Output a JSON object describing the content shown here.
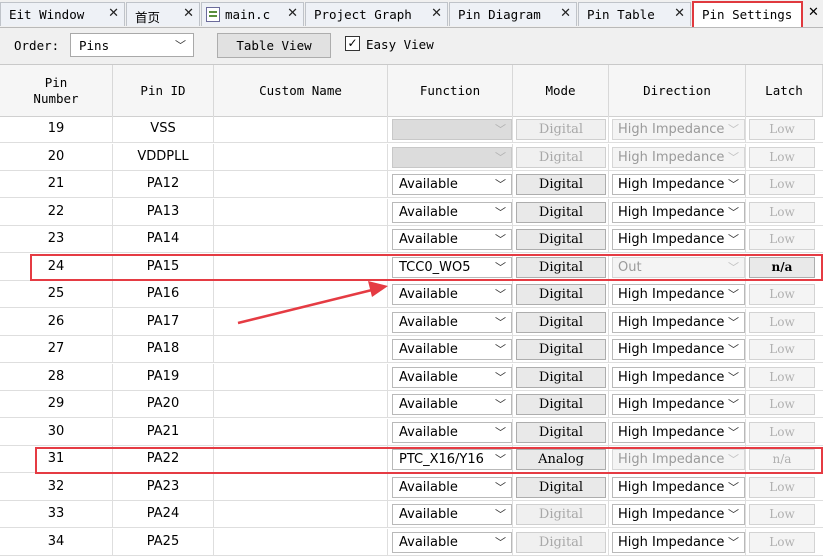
{
  "tabs": [
    {
      "label": "Eit Window",
      "active": false,
      "icon": null
    },
    {
      "label": "首页",
      "active": false,
      "icon": null
    },
    {
      "label": "main.c",
      "active": false,
      "icon": "c-file-icon"
    },
    {
      "label": "Project Graph",
      "active": false,
      "icon": null
    },
    {
      "label": "Pin Diagram",
      "active": false,
      "icon": null
    },
    {
      "label": "Pin Table",
      "active": false,
      "icon": null
    },
    {
      "label": "Pin Settings",
      "active": true,
      "icon": null
    }
  ],
  "toolbar": {
    "order_label": "Order:",
    "order_value": "Pins",
    "table_view_label": "Table View",
    "easy_view_label": "Easy View",
    "easy_view_checked": true
  },
  "columns": [
    "Pin Number",
    "Pin ID",
    "Custom Name",
    "Function",
    "Mode",
    "Direction",
    "Latch"
  ],
  "rows": [
    {
      "num": "19",
      "id": "VSS",
      "custom": "",
      "function": "",
      "function_enabled": false,
      "mode": "Digital",
      "mode_enabled": false,
      "direction": "High Impedance",
      "direction_enabled": false,
      "latch": "Low",
      "latch_enabled": false,
      "highlight": false
    },
    {
      "num": "20",
      "id": "VDDPLL",
      "custom": "",
      "function": "",
      "function_enabled": false,
      "mode": "Digital",
      "mode_enabled": false,
      "direction": "High Impedance",
      "direction_enabled": false,
      "latch": "Low",
      "latch_enabled": false,
      "highlight": false
    },
    {
      "num": "21",
      "id": "PA12",
      "custom": "",
      "function": "Available",
      "function_enabled": true,
      "mode": "Digital",
      "mode_enabled": true,
      "direction": "High Impedance",
      "direction_enabled": true,
      "latch": "Low",
      "latch_enabled": false,
      "highlight": false
    },
    {
      "num": "22",
      "id": "PA13",
      "custom": "",
      "function": "Available",
      "function_enabled": true,
      "mode": "Digital",
      "mode_enabled": true,
      "direction": "High Impedance",
      "direction_enabled": true,
      "latch": "Low",
      "latch_enabled": false,
      "highlight": false
    },
    {
      "num": "23",
      "id": "PA14",
      "custom": "",
      "function": "Available",
      "function_enabled": true,
      "mode": "Digital",
      "mode_enabled": true,
      "direction": "High Impedance",
      "direction_enabled": true,
      "latch": "Low",
      "latch_enabled": false,
      "highlight": false
    },
    {
      "num": "24",
      "id": "PA15",
      "custom": "",
      "function": "TCC0_WO5",
      "function_enabled": true,
      "mode": "Digital",
      "mode_enabled": true,
      "direction": "Out",
      "direction_enabled": false,
      "latch": "n/a",
      "latch_enabled": true,
      "highlight": true
    },
    {
      "num": "25",
      "id": "PA16",
      "custom": "",
      "function": "Available",
      "function_enabled": true,
      "mode": "Digital",
      "mode_enabled": true,
      "direction": "High Impedance",
      "direction_enabled": true,
      "latch": "Low",
      "latch_enabled": false,
      "highlight": false
    },
    {
      "num": "26",
      "id": "PA17",
      "custom": "",
      "function": "Available",
      "function_enabled": true,
      "mode": "Digital",
      "mode_enabled": true,
      "direction": "High Impedance",
      "direction_enabled": true,
      "latch": "Low",
      "latch_enabled": false,
      "highlight": false
    },
    {
      "num": "27",
      "id": "PA18",
      "custom": "",
      "function": "Available",
      "function_enabled": true,
      "mode": "Digital",
      "mode_enabled": true,
      "direction": "High Impedance",
      "direction_enabled": true,
      "latch": "Low",
      "latch_enabled": false,
      "highlight": false
    },
    {
      "num": "28",
      "id": "PA19",
      "custom": "",
      "function": "Available",
      "function_enabled": true,
      "mode": "Digital",
      "mode_enabled": true,
      "direction": "High Impedance",
      "direction_enabled": true,
      "latch": "Low",
      "latch_enabled": false,
      "highlight": false
    },
    {
      "num": "29",
      "id": "PA20",
      "custom": "",
      "function": "Available",
      "function_enabled": true,
      "mode": "Digital",
      "mode_enabled": true,
      "direction": "High Impedance",
      "direction_enabled": true,
      "latch": "Low",
      "latch_enabled": false,
      "highlight": false
    },
    {
      "num": "30",
      "id": "PA21",
      "custom": "",
      "function": "Available",
      "function_enabled": true,
      "mode": "Digital",
      "mode_enabled": true,
      "direction": "High Impedance",
      "direction_enabled": true,
      "latch": "Low",
      "latch_enabled": false,
      "highlight": false
    },
    {
      "num": "31",
      "id": "PA22",
      "custom": "",
      "function": "PTC_X16/Y16",
      "function_enabled": true,
      "mode": "Analog",
      "mode_enabled": true,
      "direction": "High Impedance",
      "direction_enabled": false,
      "latch": "n/a",
      "latch_enabled": false,
      "highlight": true
    },
    {
      "num": "32",
      "id": "PA23",
      "custom": "",
      "function": "Available",
      "function_enabled": true,
      "mode": "Digital",
      "mode_enabled": true,
      "direction": "High Impedance",
      "direction_enabled": true,
      "latch": "Low",
      "latch_enabled": false,
      "highlight": false
    },
    {
      "num": "33",
      "id": "PA24",
      "custom": "",
      "function": "Available",
      "function_enabled": true,
      "mode": "Digital",
      "mode_enabled": false,
      "direction": "High Impedance",
      "direction_enabled": true,
      "latch": "Low",
      "latch_enabled": false,
      "highlight": false
    },
    {
      "num": "34",
      "id": "PA25",
      "custom": "",
      "function": "Available",
      "function_enabled": true,
      "mode": "Digital",
      "mode_enabled": false,
      "direction": "High Impedance",
      "direction_enabled": true,
      "latch": "Low",
      "latch_enabled": false,
      "highlight": false
    }
  ],
  "colors": {
    "highlight": "#e53b43",
    "active_tab_border": "#e0393e",
    "disabled_text": "#a8a8a8"
  }
}
